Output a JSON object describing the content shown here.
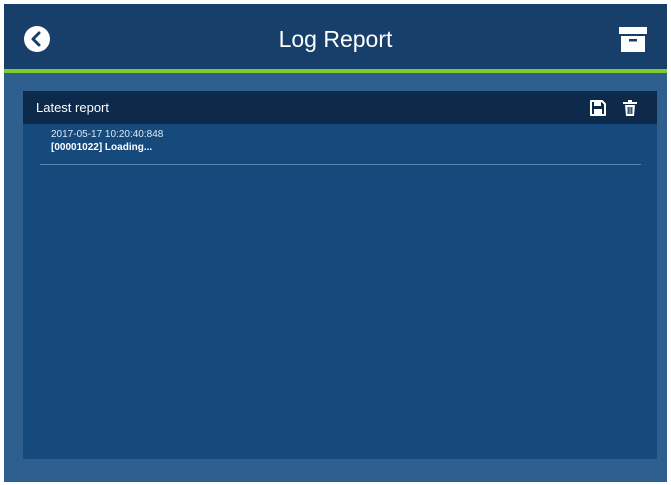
{
  "header": {
    "title": "Log Report",
    "back_icon": "chevron-left-circle-icon",
    "archive_icon": "archive-box-icon",
    "accent_color": "#7ccc2f"
  },
  "panel": {
    "title": "Latest report",
    "save_icon": "floppy-disk-icon",
    "delete_icon": "trash-icon",
    "entries": [
      {
        "timestamp": "2017-05-17 10:20:40:848",
        "message": "[00001022] Loading..."
      }
    ]
  },
  "colors": {
    "topbar": "#173f6a",
    "background": "#2f5f8e",
    "panel": "#164a7c",
    "panel_header": "#0e2a4b"
  }
}
